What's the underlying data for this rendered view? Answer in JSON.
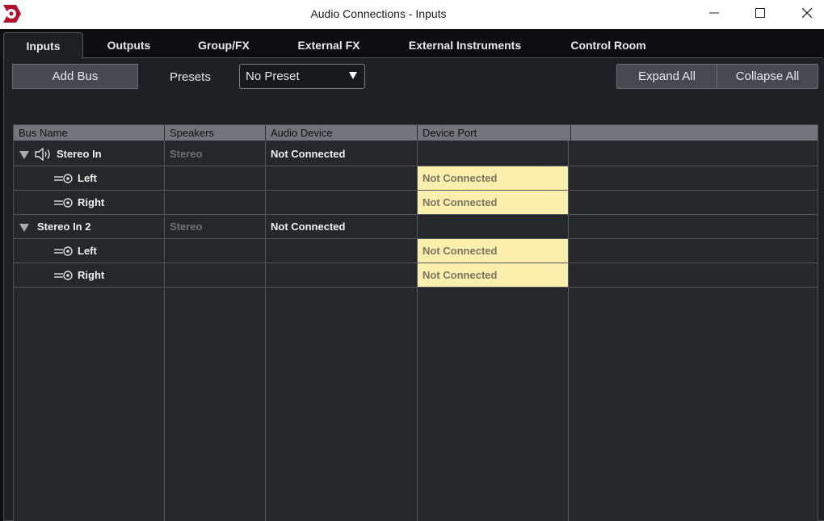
{
  "window": {
    "title": "Audio Connections - Inputs",
    "controls": [
      "minimize-icon",
      "maximize-icon",
      "close-icon"
    ]
  },
  "tabs": [
    {
      "label": "Inputs",
      "active": true
    },
    {
      "label": "Outputs",
      "active": false
    },
    {
      "label": "Group/FX",
      "active": false
    },
    {
      "label": "External FX",
      "active": false
    },
    {
      "label": "External Instruments",
      "active": false
    },
    {
      "label": "Control Room",
      "active": false
    }
  ],
  "toolbar": {
    "add_bus_label": "Add Bus",
    "presets_label": "Presets",
    "preset_value": "No Preset",
    "expand_all_label": "Expand All",
    "collapse_all_label": "Collapse All"
  },
  "table": {
    "columns": [
      "Bus Name",
      "Speakers",
      "Audio Device",
      "Device Port"
    ],
    "rows": [
      {
        "type": "bus",
        "name": "Stereo In",
        "speakers": "Stereo",
        "device": "Not Connected",
        "port": "",
        "icon": "speaker-icon"
      },
      {
        "type": "channel",
        "name": "Left",
        "speakers": "",
        "device": "",
        "port": "Not Connected",
        "icon": "plug-icon"
      },
      {
        "type": "channel",
        "name": "Right",
        "speakers": "",
        "device": "",
        "port": "Not Connected",
        "icon": "plug-icon"
      },
      {
        "type": "bus",
        "name": "Stereo In 2",
        "speakers": "Stereo",
        "device": "Not Connected",
        "port": ""
      },
      {
        "type": "channel",
        "name": "Left",
        "speakers": "",
        "device": "",
        "port": "Not Connected",
        "icon": "plug-icon"
      },
      {
        "type": "channel",
        "name": "Right",
        "speakers": "",
        "device": "",
        "port": "Not Connected",
        "icon": "plug-icon"
      }
    ]
  },
  "colors": {
    "accent_logo": "#b0102a",
    "port_highlight": "#faeeac",
    "panel_bg": "#1e2024"
  }
}
